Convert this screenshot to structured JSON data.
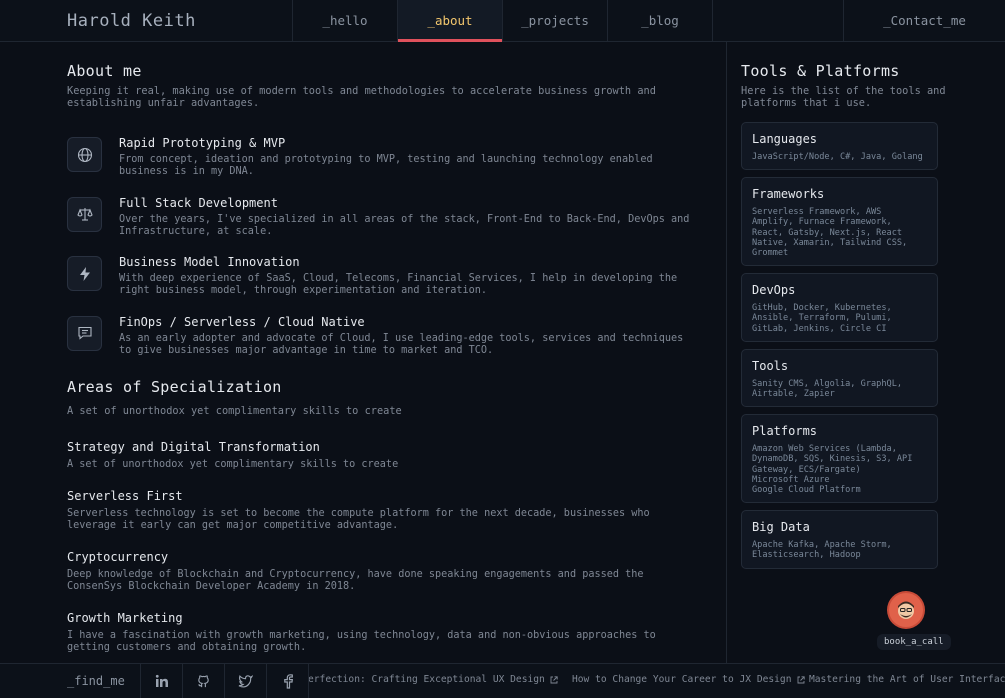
{
  "nav": {
    "brand": "Harold Keith",
    "tabs": [
      "_hello",
      "_about",
      "_projects",
      "_blog"
    ],
    "active_tab": "_about",
    "contact": "_Contact_me"
  },
  "about": {
    "title": "About me",
    "subtitle": "Keeping it real, making use of modern tools and methodologies to accelerate business growth and establishing unfair advantages.",
    "services": [
      {
        "icon": "globe-icon",
        "title": "Rapid Prototyping & MVP",
        "desc": "From concept, ideation and prototyping to MVP, testing and launching technology enabled business is in my DNA."
      },
      {
        "icon": "scale-icon",
        "title": "Full Stack Development",
        "desc": "Over the years, I've specialized in all areas of the stack, Front-End to Back-End, DevOps and Infrastructure, at scale."
      },
      {
        "icon": "lightning-icon",
        "title": "Business Model Innovation",
        "desc": "With deep experience of SaaS, Cloud, Telecoms, Financial Services, I help in developing the right business model, through experimentation and iteration."
      },
      {
        "icon": "chat-icon",
        "title": "FinOps / Serverless / Cloud Native",
        "desc": "As an early adopter and advocate of Cloud, I use leading-edge tools, services and techniques to give businesses major advantage in time to market and TCO."
      }
    ]
  },
  "specialization": {
    "title": "Areas of Specialization",
    "subtitle": "A set of unorthodox yet complimentary skills to create",
    "items": [
      {
        "title": "Strategy and Digital Transformation",
        "desc": "A set of unorthodox yet complimentary skills to create"
      },
      {
        "title": "Serverless First",
        "desc": "Serverless technology is set to become the compute platform for the next decade, businesses who leverage it early can get major competitive advantage."
      },
      {
        "title": "Cryptocurrency",
        "desc": "Deep knowledge of Blockchain and Cryptocurrency, have done speaking engagements and passed the ConsenSys Blockchain Developer Academy in 2018."
      },
      {
        "title": "Growth Marketing",
        "desc": "I have a fascination with growth marketing, using technology, data and non-obvious approaches to getting customers and obtaining growth."
      }
    ]
  },
  "tools": {
    "title": "Tools & Platforms",
    "subtitle": "Here is the list of the tools and platforms that i use.",
    "cards": [
      {
        "title": "Languages",
        "body": "JavaScript/Node, C#, Java, Golang"
      },
      {
        "title": "Frameworks",
        "body": "Serverless Framework, AWS Amplify, Furnace Framework, React, Gatsby, Next.js, React Native, Xamarin, Tailwind CSS, Grommet"
      },
      {
        "title": "DevOps",
        "body": "GitHub, Docker, Kubernetes, Ansible, Terraform, Pulumi, GitLab, Jenkins, Circle CI"
      },
      {
        "title": "Tools",
        "body": "Sanity CMS, Algolia, GraphQL, Airtable, Zapier"
      },
      {
        "title": "Platforms",
        "body": "Amazon Web Services (Lambda, DynamoDB, SQS, Kinesis, S3, API Gateway, ECS/Fargate)\nMicrosoft Azure\nGoogle Cloud Platform"
      },
      {
        "title": "Big Data",
        "body": "Apache Kafka, Apache Storm, Elasticsearch, Hadoop"
      }
    ]
  },
  "book_call": {
    "label": "book_a_call",
    "icon": "avatar-icon"
  },
  "footer": {
    "find_me": "_find_me",
    "socials": [
      "linkedin-icon",
      "github-icon",
      "twitter-icon",
      "facebook-icon"
    ],
    "ticker": [
      "erfection: Crafting Exceptional UX Design",
      "How to Change Your Career to JX Design",
      "Mastering the Art of User Interface De"
    ]
  },
  "colors": {
    "background": "#0b0f17",
    "accent_active_tab": "#f2c66d",
    "active_underline": "#e0515c",
    "avatar": "#e0614a"
  }
}
